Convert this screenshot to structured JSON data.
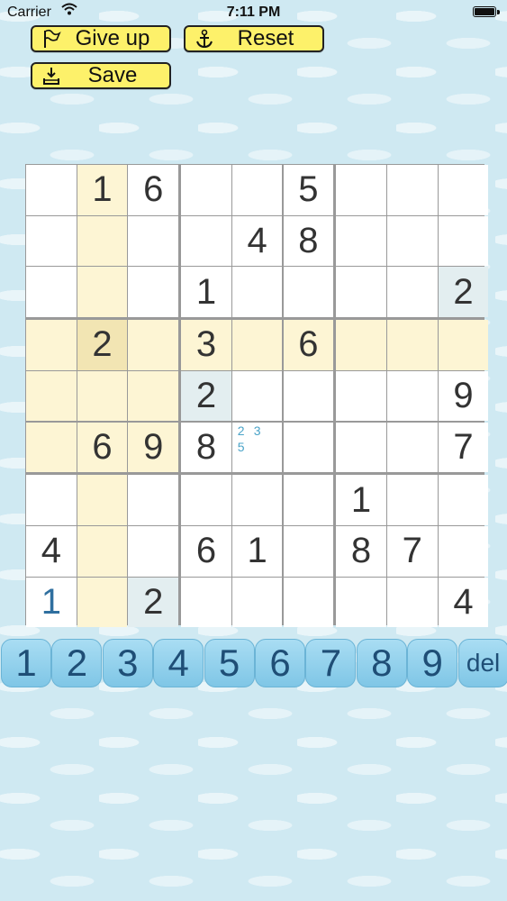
{
  "status_bar": {
    "carrier": "Carrier",
    "time": "7:11 PM"
  },
  "toolbar": {
    "give_up": "Give up",
    "reset": "Reset",
    "save": "Save"
  },
  "board": {
    "values": [
      [
        "",
        "1",
        "6",
        "",
        "",
        "5",
        "",
        "",
        ""
      ],
      [
        "",
        "",
        "",
        "",
        "4",
        "8",
        "",
        "",
        ""
      ],
      [
        "",
        "",
        "",
        "1",
        "",
        "",
        "",
        "",
        "2"
      ],
      [
        "",
        "2",
        "",
        "3",
        "",
        "6",
        "",
        "",
        ""
      ],
      [
        "",
        "",
        "",
        "2",
        "",
        "",
        "",
        "",
        "9"
      ],
      [
        "",
        "6",
        "9",
        "8",
        "",
        "",
        "",
        "",
        "7"
      ],
      [
        "",
        "",
        "",
        "",
        "",
        "",
        "1",
        "",
        ""
      ],
      [
        "4",
        "",
        "",
        "6",
        "1",
        "",
        "8",
        "7",
        ""
      ],
      [
        "1",
        "",
        "2",
        "",
        "",
        "",
        "",
        "",
        "4"
      ]
    ],
    "user_cells": [
      [
        8,
        0
      ]
    ],
    "selected": [
      3,
      1
    ],
    "same_number_cells": [
      [
        2,
        8
      ],
      [
        4,
        3
      ],
      [
        8,
        2
      ]
    ],
    "notes": {
      "5,4": [
        "2",
        "3",
        "",
        "5",
        "",
        "",
        "",
        "",
        ""
      ]
    }
  },
  "keypad": {
    "keys": [
      "1",
      "2",
      "3",
      "4",
      "5",
      "6",
      "7",
      "8",
      "9",
      "del"
    ]
  }
}
